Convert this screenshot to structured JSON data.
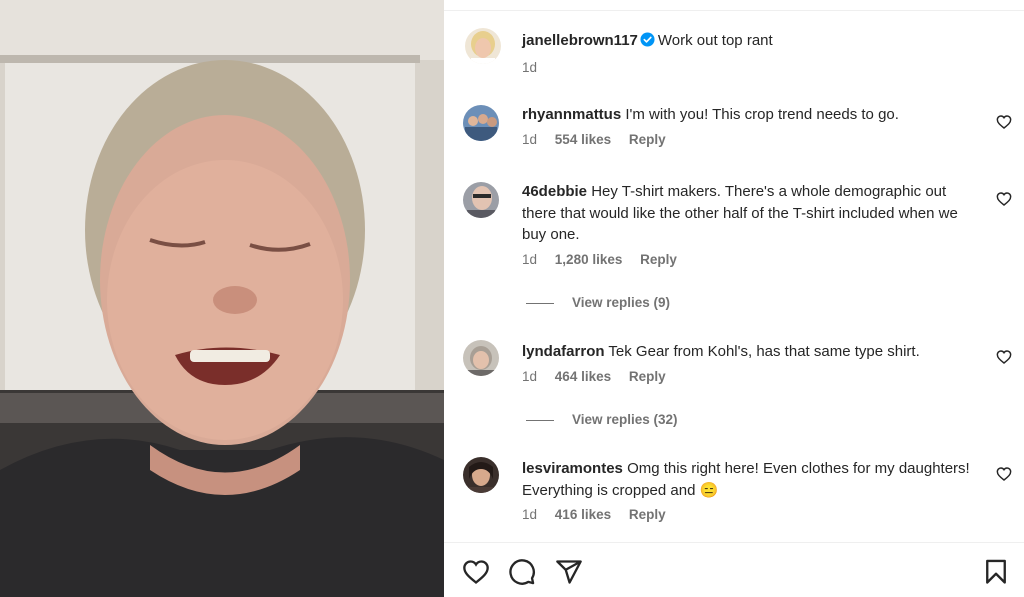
{
  "post": {
    "author": "janellebrown117",
    "caption": "Work out top rant",
    "time": "1d",
    "verified": true
  },
  "comments": [
    {
      "user": "rhyannmattus",
      "text": "I'm with you! This crop trend needs to go.",
      "time": "1d",
      "likes": "554 likes",
      "reply": "Reply"
    },
    {
      "user": "46debbie",
      "text": "Hey T-shirt makers. There's a whole demographic out there that would like the other half of the T-shirt included when we buy one.",
      "time": "1d",
      "likes": "1,280 likes",
      "reply": "Reply",
      "view_replies": "View replies (9)"
    },
    {
      "user": "lyndafarron",
      "text": "Tek Gear from Kohl's, has that same type shirt.",
      "time": "1d",
      "likes": "464 likes",
      "reply": "Reply",
      "view_replies": "View replies (32)"
    },
    {
      "user": "lesviramontes",
      "text": "Omg this right here! Even clothes for my daughters! Everything is cropped and 😑",
      "time": "1d",
      "likes": "416 likes",
      "reply": "Reply"
    }
  ],
  "icons": {
    "like": "heart-icon",
    "comment": "comment-icon",
    "share": "share-icon",
    "save": "bookmark-icon",
    "verified": "verified-badge-icon"
  },
  "colors": {
    "text": "#262626",
    "secondary": "#737373",
    "verified": "#0095f6",
    "divider": "#efefef"
  }
}
